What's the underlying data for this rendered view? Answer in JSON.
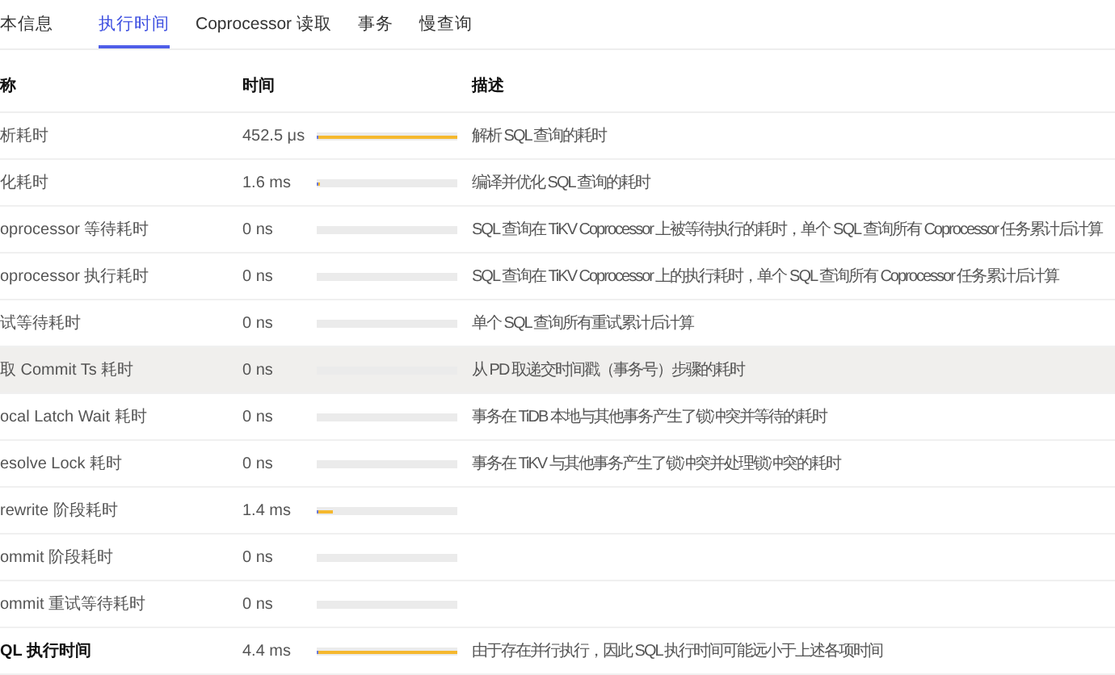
{
  "tabs": [
    {
      "label": "本信息",
      "selected": false
    },
    {
      "label": "执行时间",
      "selected": true
    },
    {
      "label": "Coprocessor 读取",
      "selected": false
    },
    {
      "label": "事务",
      "selected": false
    },
    {
      "label": "慢查询",
      "selected": false
    }
  ],
  "table": {
    "columns": [
      "称",
      "时间",
      "描述"
    ],
    "rows": [
      {
        "name": "析耗时",
        "time": "452.5 μs",
        "level": 1,
        "description": "解析 SQL 查询的耗时",
        "highlighted": false,
        "kind": "normal"
      },
      {
        "name": "化耗时",
        "time": "1.6 ms",
        "level": 0.02,
        "description": "编译并优化 SQL 查询的耗时",
        "highlighted": false,
        "kind": "normal"
      },
      {
        "name": "oprocessor 等待耗时",
        "time": "0 ns",
        "description": "SQL 查询在 TiKV Coprocessor 上被等待执行的耗时，单个 SQL 查询所有 Coprocessor 任务累计后计算",
        "highlighted": false,
        "kind": "normal"
      },
      {
        "name": "oprocessor 执行耗时",
        "time": "0 ns",
        "description": "SQL 查询在 TiKV Coprocessor 上的执行耗时，单个 SQL 查询所有 Coprocessor 任务累计后计算",
        "highlighted": false,
        "kind": "normal"
      },
      {
        "name": "试等待耗时",
        "time": "0 ns",
        "description": "单个 SQL 查询所有重试累计后计算",
        "highlighted": false,
        "kind": "normal"
      },
      {
        "name": "取 Commit Ts 耗时",
        "time": "0 ns",
        "description": "从 PD 取递交时间戳（事务号）步骤的耗时",
        "highlighted": true,
        "kind": "normal"
      },
      {
        "name": "ocal Latch Wait 耗时",
        "time": "0 ns",
        "description": "事务在 TiDB 本地与其他事务产生了锁冲突并等待的耗时",
        "highlighted": false,
        "kind": "normal"
      },
      {
        "name": "esolve Lock 耗时",
        "time": "0 ns",
        "description": "事务在 TiKV 与其他事务产生了锁冲突并处理锁冲突的耗时",
        "highlighted": false,
        "kind": "normal"
      },
      {
        "name": "rewrite 阶段耗时",
        "time": "1.4 ms",
        "level": 0.12,
        "highlighted": false,
        "kind": "normal"
      },
      {
        "name": "ommit 阶段耗时",
        "time": "0 ns",
        "highlighted": false,
        "kind": "normal"
      },
      {
        "name": "ommit 重试等待耗时",
        "time": "0 ns",
        "highlighted": false,
        "kind": "normal"
      },
      {
        "name": "QL 执行时间",
        "time": "4.4 ms",
        "level": 1,
        "description": "由于存在并行执行，因此 SQL 执行时间可能远小于上述各项时间",
        "highlighted": false,
        "kind": "total"
      }
    ]
  }
}
